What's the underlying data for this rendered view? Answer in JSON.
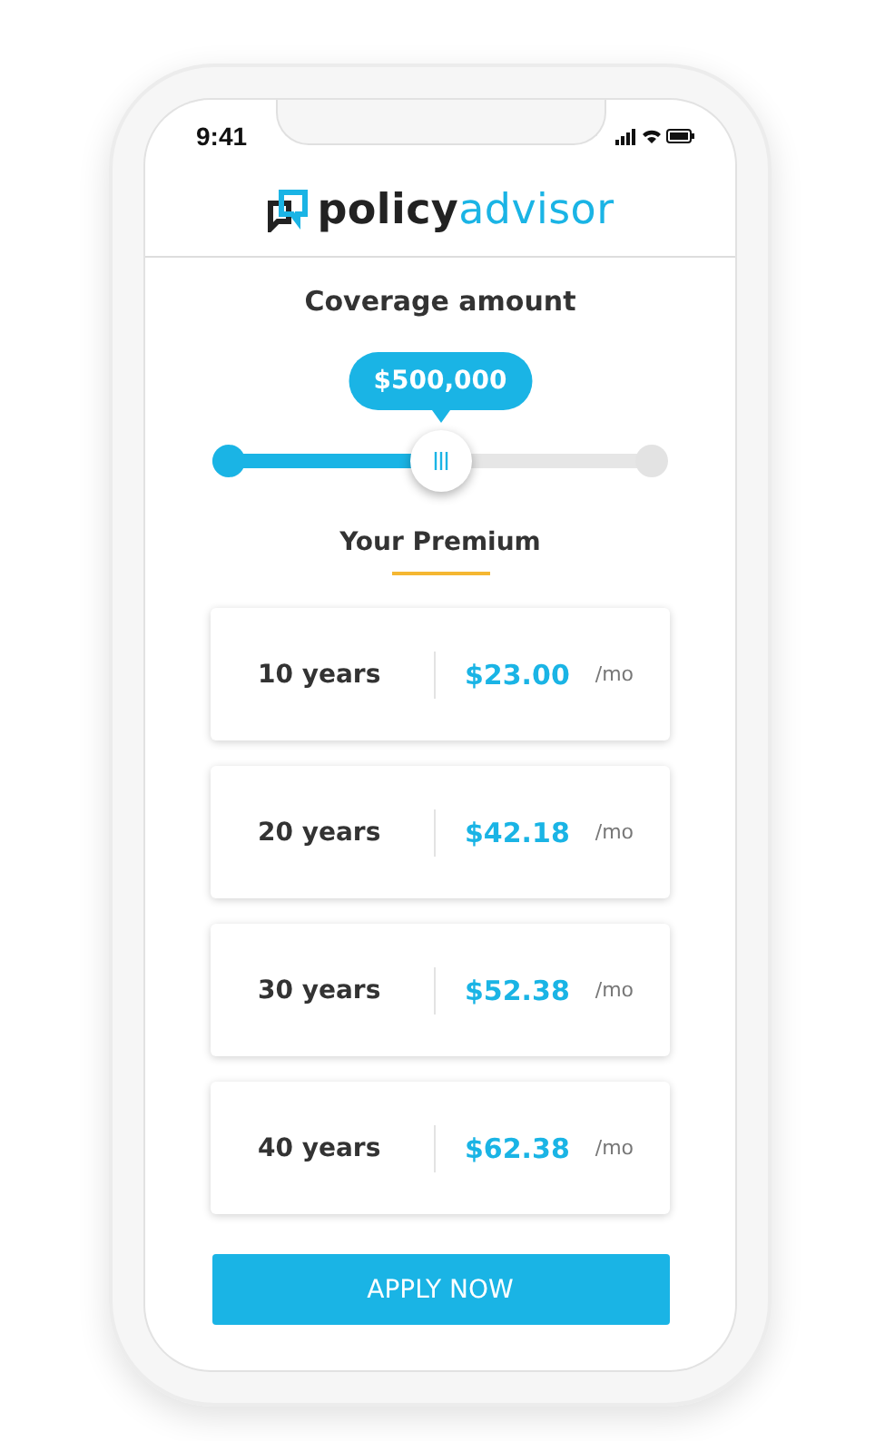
{
  "status_bar": {
    "time": "9:41"
  },
  "logo": {
    "part1": "policy",
    "part2": "advisor"
  },
  "coverage": {
    "title": "Coverage amount",
    "amount": "$500,000",
    "level": 0.5
  },
  "premium": {
    "title": "Your Premium"
  },
  "plans": [
    {
      "term": "10 years",
      "price": "$23.00",
      "unit": "/mo"
    },
    {
      "term": "20 years",
      "price": "$42.18",
      "unit": "/mo"
    },
    {
      "term": "30 years",
      "price": "$52.38",
      "unit": "/mo"
    },
    {
      "term": "40 years",
      "price": "$62.38",
      "unit": "/mo"
    }
  ],
  "button": "APPLY NOW"
}
